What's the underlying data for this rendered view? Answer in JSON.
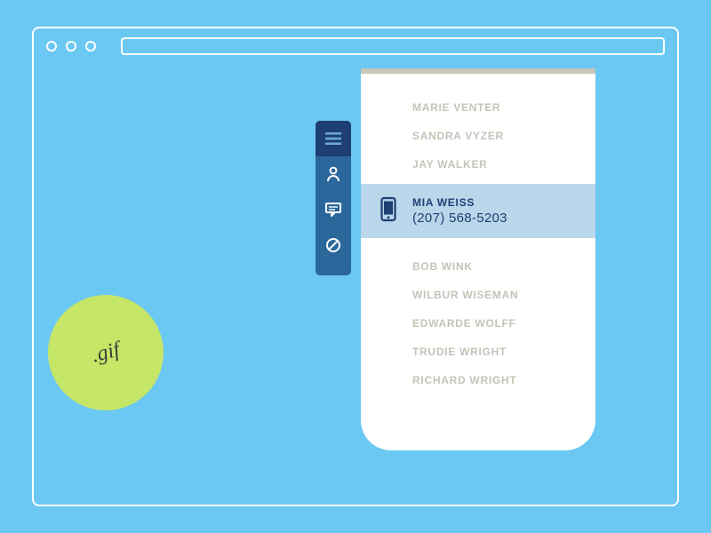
{
  "badge": {
    "label": ".gif"
  },
  "sidebar": {
    "items": [
      {
        "name": "menu"
      },
      {
        "name": "contacts"
      },
      {
        "name": "messages"
      },
      {
        "name": "block"
      }
    ]
  },
  "contacts": {
    "before": [
      "MARIE VENTER",
      "SANDRA VYZER",
      "JAY WALKER"
    ],
    "selected": {
      "name": "MIA WEISS",
      "phone": "(207) 568-5203"
    },
    "after": [
      "BOB WINK",
      "WILBUR WISEMAN",
      "EDWARDE WOLFF",
      "TRUDIE WRIGHT",
      "RICHARD WRIGHT"
    ]
  }
}
